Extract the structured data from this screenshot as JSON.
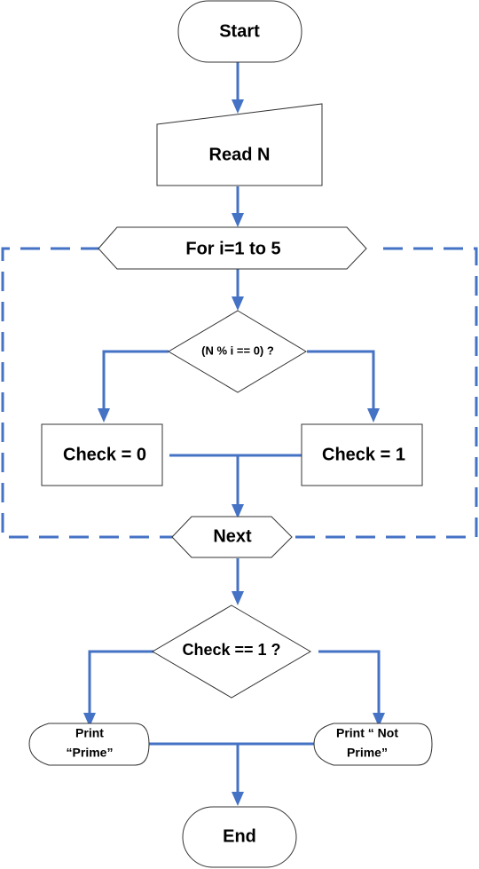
{
  "diagram": {
    "type": "flowchart",
    "colors": {
      "connector": "#4472c4",
      "shape_stroke": "#333333",
      "fill": "#ffffff",
      "text": "#000000"
    },
    "nodes": {
      "start": {
        "label": "Start",
        "shape": "terminator"
      },
      "read": {
        "label": "Read N",
        "shape": "manual-input"
      },
      "loop": {
        "label": "For i=1 to 5",
        "shape": "loop-limit"
      },
      "cond1": {
        "label": "(N % i == 0) ?",
        "shape": "decision"
      },
      "check0": {
        "label": "Check = 0",
        "shape": "process"
      },
      "check1": {
        "label": "Check = 1",
        "shape": "process"
      },
      "next": {
        "label": "Next",
        "shape": "loop-limit"
      },
      "cond2": {
        "label": "Check == 1 ?",
        "shape": "decision"
      },
      "prime": {
        "line1": "Print",
        "line2": "“Prime”",
        "shape": "display"
      },
      "notprime": {
        "line1": "Print “ Not",
        "line2": "Prime”",
        "shape": "display"
      },
      "end": {
        "label": "End",
        "shape": "terminator"
      }
    },
    "edges": [
      [
        "start",
        "read"
      ],
      [
        "read",
        "loop"
      ],
      [
        "loop",
        "cond1"
      ],
      [
        "cond1",
        "check0"
      ],
      [
        "cond1",
        "check1"
      ],
      [
        "check0",
        "next"
      ],
      [
        "check1",
        "next"
      ],
      [
        "next",
        "cond2"
      ],
      [
        "cond2",
        "prime"
      ],
      [
        "cond2",
        "notprime"
      ],
      [
        "prime",
        "end"
      ],
      [
        "notprime",
        "end"
      ]
    ]
  }
}
